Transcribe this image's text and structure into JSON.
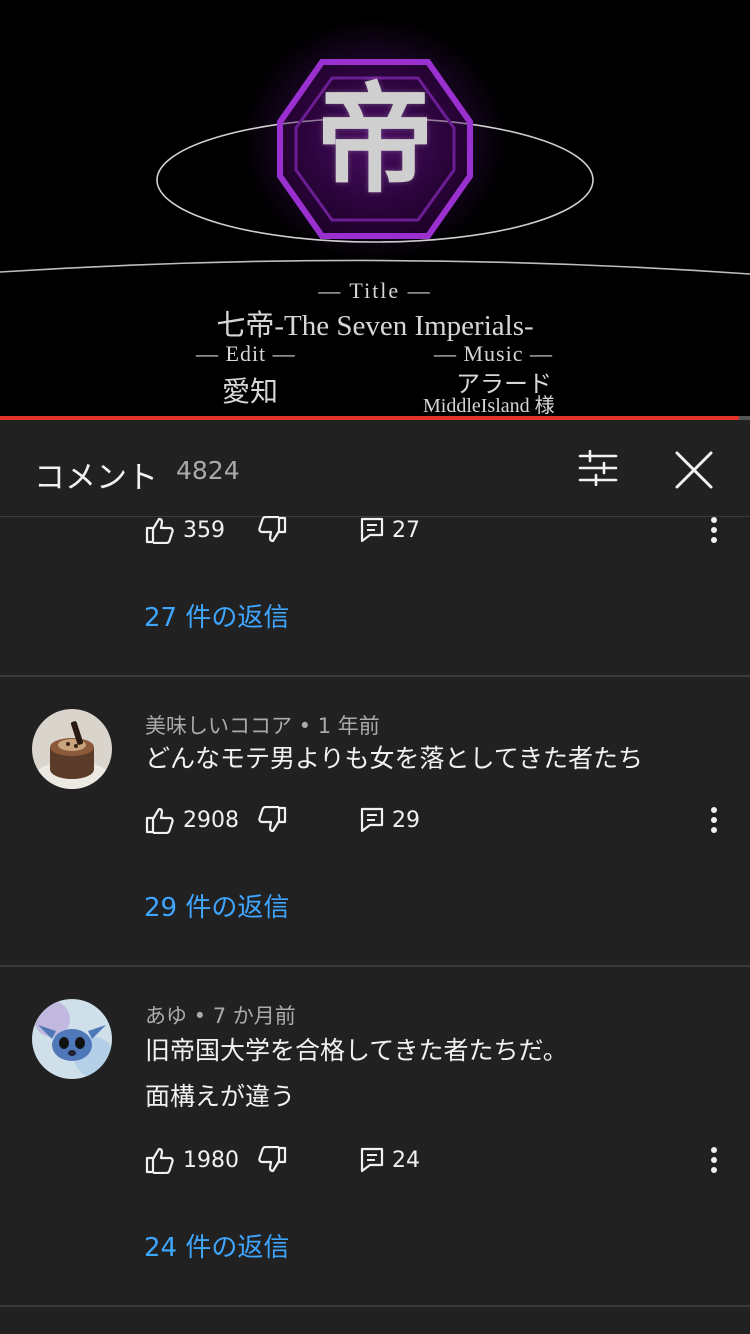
{
  "video": {
    "title_label": "— Title —",
    "title": "七帝-The Seven Imperials-",
    "edit_label": "— Edit —",
    "edit_name": "愛知",
    "music_label": "— Music —",
    "music_name": "アラード",
    "music_sub": "MiddleIsland 様",
    "emblem": "帝",
    "progress": 0.985
  },
  "panel": {
    "title": "コメント",
    "count": "4824"
  },
  "top_comment": {
    "likes": "359",
    "reply_count": "27",
    "replies_link": "27 件の返信"
  },
  "comments": [
    {
      "author": "美味しいココア • 1 年前",
      "lines": [
        "どんなモテ男よりも女を落としてきた者たち"
      ],
      "likes": "2908",
      "reply_count": "29",
      "replies_link": "29 件の返信"
    },
    {
      "author": "あゆ • 7 か月前",
      "lines": [
        "旧帝国大学を合格してきた者たちだ。",
        "面構えが違う"
      ],
      "likes": "1980",
      "reply_count": "24",
      "replies_link": "24 件の返信"
    }
  ],
  "colors": {
    "background": "#212121",
    "link": "#3ea6ff",
    "progress": "#e3322a",
    "accent_purple": "#9b30d0"
  },
  "icons": [
    "filter-icon",
    "close-icon",
    "thumb-up-icon",
    "thumb-down-icon",
    "reply-icon",
    "more-vert-icon"
  ]
}
